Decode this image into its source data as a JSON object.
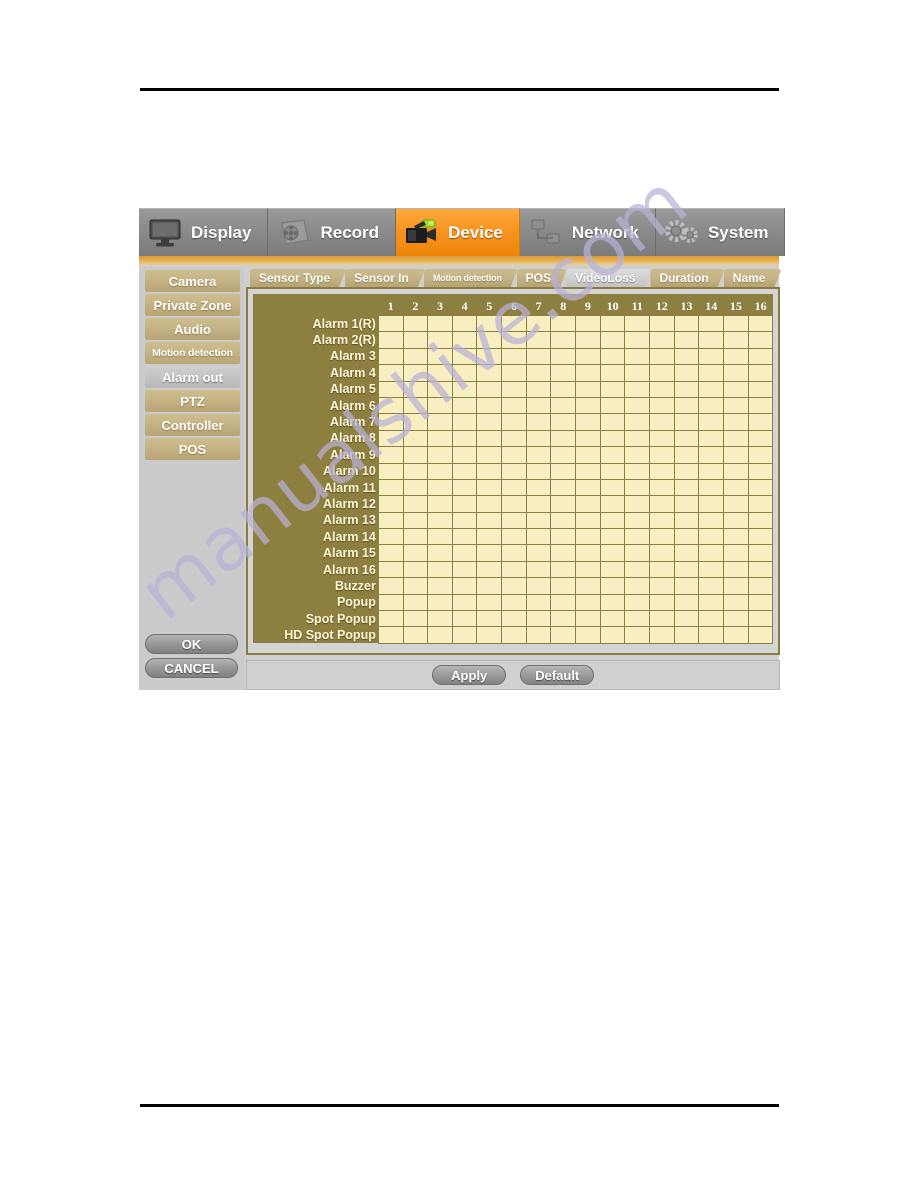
{
  "watermark": {
    "text": "manualshive.com"
  },
  "menu": {
    "items": [
      {
        "label": "Display",
        "icon": "monitor-icon",
        "active": false
      },
      {
        "label": "Record",
        "icon": "film-reel-icon",
        "active": false
      },
      {
        "label": "Device",
        "icon": "camcorder-icon",
        "active": true
      },
      {
        "label": "Network",
        "icon": "network-icon",
        "active": false
      },
      {
        "label": "System",
        "icon": "gears-icon",
        "active": false
      }
    ]
  },
  "sidebar": {
    "items": [
      {
        "label": "Camera",
        "selected": false,
        "small": false
      },
      {
        "label": "Private Zone",
        "selected": false,
        "small": false
      },
      {
        "label": "Audio",
        "selected": false,
        "small": false
      },
      {
        "label": "Motion detection",
        "selected": false,
        "small": true
      },
      {
        "label": "Alarm out",
        "selected": true,
        "small": false
      },
      {
        "label": "PTZ",
        "selected": false,
        "small": false
      },
      {
        "label": "Controller",
        "selected": false,
        "small": false
      },
      {
        "label": "POS",
        "selected": false,
        "small": false
      }
    ],
    "ok_label": "OK",
    "cancel_label": "CANCEL"
  },
  "tabs": [
    {
      "label": "Sensor Type",
      "selected": false,
      "tiny": false
    },
    {
      "label": "Sensor In",
      "selected": false,
      "tiny": false
    },
    {
      "label": "Motion detection",
      "selected": false,
      "tiny": true
    },
    {
      "label": "POS",
      "selected": false,
      "tiny": false
    },
    {
      "label": "VideoLoss",
      "selected": true,
      "tiny": false
    },
    {
      "label": "Duration",
      "selected": false,
      "tiny": false
    },
    {
      "label": "Name",
      "selected": false,
      "tiny": false
    }
  ],
  "matrix": {
    "columns": [
      "1",
      "2",
      "3",
      "4",
      "5",
      "6",
      "7",
      "8",
      "9",
      "10",
      "11",
      "12",
      "13",
      "14",
      "15",
      "16"
    ],
    "rows": [
      {
        "label": "Alarm 1(R)",
        "checks": [
          0,
          0,
          0,
          0,
          0,
          0,
          0,
          0,
          0,
          0,
          0,
          0,
          0,
          0,
          0,
          0
        ]
      },
      {
        "label": "Alarm 2(R)",
        "checks": [
          0,
          0,
          0,
          0,
          0,
          0,
          0,
          0,
          0,
          0,
          0,
          0,
          0,
          0,
          0,
          0
        ]
      },
      {
        "label": "Alarm 3",
        "checks": [
          0,
          0,
          0,
          0,
          0,
          0,
          0,
          0,
          0,
          0,
          0,
          0,
          0,
          0,
          0,
          0
        ]
      },
      {
        "label": "Alarm 4",
        "checks": [
          0,
          0,
          0,
          0,
          0,
          0,
          0,
          0,
          0,
          0,
          0,
          0,
          0,
          0,
          0,
          0
        ]
      },
      {
        "label": "Alarm 5",
        "checks": [
          0,
          0,
          0,
          0,
          0,
          0,
          0,
          0,
          0,
          0,
          0,
          0,
          0,
          0,
          0,
          0
        ]
      },
      {
        "label": "Alarm 6",
        "checks": [
          0,
          0,
          0,
          0,
          0,
          0,
          0,
          0,
          0,
          0,
          0,
          0,
          0,
          0,
          0,
          0
        ]
      },
      {
        "label": "Alarm 7",
        "checks": [
          0,
          0,
          0,
          0,
          0,
          0,
          0,
          0,
          0,
          0,
          0,
          0,
          0,
          0,
          0,
          0
        ]
      },
      {
        "label": "Alarm 8",
        "checks": [
          0,
          0,
          0,
          0,
          0,
          0,
          0,
          0,
          0,
          0,
          0,
          0,
          0,
          0,
          0,
          0
        ]
      },
      {
        "label": "Alarm 9",
        "checks": [
          0,
          0,
          0,
          0,
          0,
          0,
          0,
          0,
          0,
          0,
          0,
          0,
          0,
          0,
          0,
          0
        ]
      },
      {
        "label": "Alarm 10",
        "checks": [
          0,
          0,
          0,
          0,
          0,
          0,
          0,
          0,
          0,
          0,
          0,
          0,
          0,
          0,
          0,
          0
        ]
      },
      {
        "label": "Alarm 11",
        "checks": [
          0,
          0,
          0,
          0,
          0,
          0,
          0,
          0,
          0,
          0,
          0,
          0,
          0,
          0,
          0,
          0
        ]
      },
      {
        "label": "Alarm 12",
        "checks": [
          0,
          0,
          0,
          0,
          0,
          0,
          0,
          0,
          0,
          0,
          0,
          0,
          0,
          0,
          0,
          0
        ]
      },
      {
        "label": "Alarm 13",
        "checks": [
          0,
          0,
          0,
          0,
          0,
          0,
          0,
          0,
          0,
          0,
          0,
          0,
          0,
          0,
          0,
          0
        ]
      },
      {
        "label": "Alarm 14",
        "checks": [
          0,
          0,
          0,
          0,
          0,
          0,
          0,
          0,
          0,
          0,
          0,
          0,
          0,
          0,
          0,
          0
        ]
      },
      {
        "label": "Alarm 15",
        "checks": [
          0,
          0,
          0,
          0,
          0,
          0,
          0,
          0,
          0,
          0,
          0,
          0,
          0,
          0,
          0,
          0
        ]
      },
      {
        "label": "Alarm 16",
        "checks": [
          0,
          0,
          0,
          0,
          0,
          0,
          0,
          0,
          0,
          0,
          0,
          0,
          0,
          0,
          0,
          0
        ]
      },
      {
        "label": "Buzzer",
        "checks": [
          0,
          0,
          0,
          0,
          0,
          0,
          0,
          0,
          0,
          0,
          0,
          0,
          0,
          0,
          0,
          0
        ]
      },
      {
        "label": "Popup",
        "checks": [
          0,
          0,
          0,
          0,
          0,
          0,
          0,
          0,
          0,
          0,
          0,
          0,
          0,
          0,
          0,
          0
        ]
      },
      {
        "label": "Spot Popup",
        "checks": [
          0,
          0,
          0,
          0,
          0,
          0,
          0,
          0,
          0,
          0,
          0,
          0,
          0,
          0,
          0,
          0
        ]
      },
      {
        "label": "HD Spot Popup",
        "checks": [
          0,
          0,
          0,
          0,
          0,
          0,
          0,
          0,
          0,
          0,
          0,
          0,
          0,
          0,
          0,
          0
        ]
      }
    ]
  },
  "footer": {
    "apply_label": "Apply",
    "default_label": "Default"
  },
  "colors": {
    "accent_orange": "#f79420",
    "khaki": "#c2b082",
    "olive": "#8d7f3f",
    "cell_cream": "#f7eec2",
    "window_gray": "#cfcfcf"
  }
}
